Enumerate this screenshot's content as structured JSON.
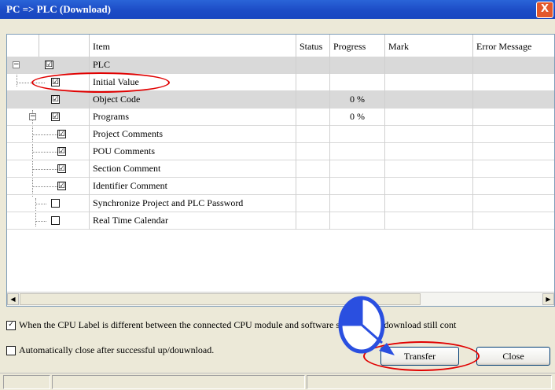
{
  "window": {
    "title": "PC => PLC (Download)",
    "close_glyph": "X"
  },
  "columns": [
    "Item",
    "Status",
    "Progress",
    "Mark",
    "Error Message"
  ],
  "rows": [
    {
      "label": "PLC",
      "checked": "☑",
      "progress": ""
    },
    {
      "label": "Initial Value",
      "checked": "☑",
      "progress": ""
    },
    {
      "label": "Object Code",
      "checked": "☑",
      "progress": "0 %"
    },
    {
      "label": "Programs",
      "checked": "☑",
      "progress": "0 %"
    },
    {
      "label": "Project Comments",
      "checked": "☑",
      "progress": ""
    },
    {
      "label": "POU Comments",
      "checked": "☑",
      "progress": ""
    },
    {
      "label": "Section Comment",
      "checked": "☑",
      "progress": ""
    },
    {
      "label": "Identifier Comment",
      "checked": "☑",
      "progress": ""
    },
    {
      "label": "Synchronize Project and PLC Password",
      "checked": "",
      "progress": ""
    },
    {
      "label": "Real Time Calendar",
      "checked": "",
      "progress": ""
    }
  ],
  "options": {
    "cpu_label_text": "When the CPU Label is different between the connected CPU module and software settings, up/ download still cont",
    "cpu_label_checked": "✓",
    "auto_close_text": "Automatically close after successful up/douwnload.",
    "auto_close_checked": ""
  },
  "buttons": {
    "transfer": "Transfer",
    "close": "Close"
  },
  "icons": {
    "collapse": "−",
    "scroll_left": "◀",
    "scroll_right": "▶"
  },
  "annotation_color": "#e00000"
}
